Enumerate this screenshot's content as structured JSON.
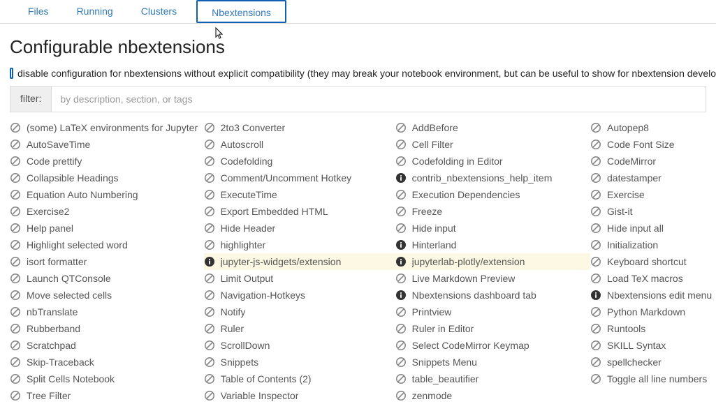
{
  "tabs": {
    "files": "Files",
    "running": "Running",
    "clusters": "Clusters",
    "nbextensions": "Nbextensions"
  },
  "title": "Configurable nbextensions",
  "compat": {
    "text": "disable configuration for nbextensions without explicit compatibility (they may break your notebook environment, but can be useful to show for nbextension develo"
  },
  "filter": {
    "label": "filter:",
    "placeholder": "by description, section, or tags"
  },
  "columns": [
    [
      {
        "label": "(some) LaTeX environments for Jupyter",
        "icon": "disabled"
      },
      {
        "label": "AutoSaveTime",
        "icon": "disabled"
      },
      {
        "label": "Code prettify",
        "icon": "disabled"
      },
      {
        "label": "Collapsible Headings",
        "icon": "disabled"
      },
      {
        "label": "Equation Auto Numbering",
        "icon": "disabled"
      },
      {
        "label": "Exercise2",
        "icon": "disabled"
      },
      {
        "label": "Help panel",
        "icon": "disabled"
      },
      {
        "label": "Highlight selected word",
        "icon": "disabled"
      },
      {
        "label": "isort formatter",
        "icon": "disabled"
      },
      {
        "label": "Launch QTConsole",
        "icon": "disabled"
      },
      {
        "label": "Move selected cells",
        "icon": "disabled"
      },
      {
        "label": "nbTranslate",
        "icon": "disabled"
      },
      {
        "label": "Rubberband",
        "icon": "disabled"
      },
      {
        "label": "Scratchpad",
        "icon": "disabled"
      },
      {
        "label": "Skip-Traceback",
        "icon": "disabled"
      },
      {
        "label": "Split Cells Notebook",
        "icon": "disabled"
      },
      {
        "label": "Tree Filter",
        "icon": "disabled"
      }
    ],
    [
      {
        "label": "2to3 Converter",
        "icon": "disabled"
      },
      {
        "label": "Autoscroll",
        "icon": "disabled"
      },
      {
        "label": "Codefolding",
        "icon": "disabled"
      },
      {
        "label": "Comment/Uncomment Hotkey",
        "icon": "disabled"
      },
      {
        "label": "ExecuteTime",
        "icon": "disabled"
      },
      {
        "label": "Export Embedded HTML",
        "icon": "disabled"
      },
      {
        "label": "Hide Header",
        "icon": "disabled"
      },
      {
        "label": "highlighter",
        "icon": "disabled"
      },
      {
        "label": "jupyter-js-widgets/extension",
        "icon": "info",
        "highlight": true
      },
      {
        "label": "Limit Output",
        "icon": "disabled"
      },
      {
        "label": "Navigation-Hotkeys",
        "icon": "disabled"
      },
      {
        "label": "Notify",
        "icon": "disabled"
      },
      {
        "label": "Ruler",
        "icon": "disabled"
      },
      {
        "label": "ScrollDown",
        "icon": "disabled"
      },
      {
        "label": "Snippets",
        "icon": "disabled"
      },
      {
        "label": "Table of Contents (2)",
        "icon": "disabled"
      },
      {
        "label": "Variable Inspector",
        "icon": "disabled"
      }
    ],
    [
      {
        "label": "AddBefore",
        "icon": "disabled"
      },
      {
        "label": "Cell Filter",
        "icon": "disabled"
      },
      {
        "label": "Codefolding in Editor",
        "icon": "disabled"
      },
      {
        "label": "contrib_nbextensions_help_item",
        "icon": "info"
      },
      {
        "label": "Execution Dependencies",
        "icon": "disabled"
      },
      {
        "label": "Freeze",
        "icon": "disabled"
      },
      {
        "label": "Hide input",
        "icon": "disabled"
      },
      {
        "label": "Hinterland",
        "icon": "info"
      },
      {
        "label": "jupyterlab-plotly/extension",
        "icon": "info",
        "highlight": true
      },
      {
        "label": "Live Markdown Preview",
        "icon": "disabled"
      },
      {
        "label": "Nbextensions dashboard tab",
        "icon": "info"
      },
      {
        "label": "Printview",
        "icon": "disabled"
      },
      {
        "label": "Ruler in Editor",
        "icon": "disabled"
      },
      {
        "label": "Select CodeMirror Keymap",
        "icon": "disabled"
      },
      {
        "label": "Snippets Menu",
        "icon": "disabled"
      },
      {
        "label": "table_beautifier",
        "icon": "disabled"
      },
      {
        "label": "zenmode",
        "icon": "disabled"
      }
    ],
    [
      {
        "label": "Autopep8",
        "icon": "disabled"
      },
      {
        "label": "Code Font Size",
        "icon": "disabled"
      },
      {
        "label": "CodeMirror",
        "icon": "disabled"
      },
      {
        "label": "datestamper",
        "icon": "disabled"
      },
      {
        "label": "Exercise",
        "icon": "disabled"
      },
      {
        "label": "Gist-it",
        "icon": "disabled"
      },
      {
        "label": "Hide input all",
        "icon": "disabled"
      },
      {
        "label": "Initialization",
        "icon": "disabled"
      },
      {
        "label": "Keyboard shortcut",
        "icon": "disabled"
      },
      {
        "label": "Load TeX macros",
        "icon": "disabled"
      },
      {
        "label": "Nbextensions edit menu item",
        "icon": "info"
      },
      {
        "label": "Python Markdown",
        "icon": "disabled"
      },
      {
        "label": "Runtools",
        "icon": "disabled"
      },
      {
        "label": "SKILL Syntax",
        "icon": "disabled"
      },
      {
        "label": "spellchecker",
        "icon": "disabled"
      },
      {
        "label": "Toggle all line numbers",
        "icon": "disabled"
      }
    ]
  ]
}
